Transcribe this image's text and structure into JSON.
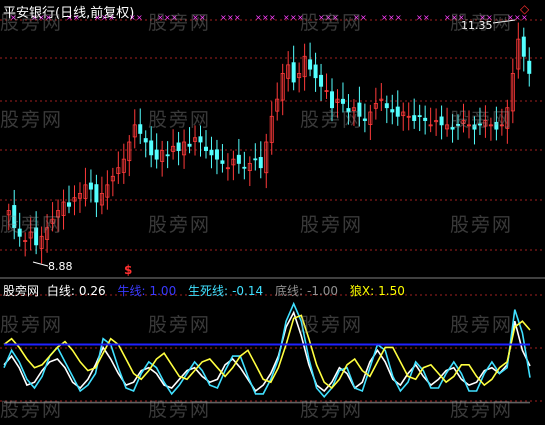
{
  "title": "平安银行(日线,前复权)",
  "price_high_label": "11.35",
  "price_low_label": "8.88",
  "signal_marker": "$",
  "diamond_glyph": "◇",
  "watermark": "股旁网",
  "indicator": {
    "name": "股旁网",
    "items": [
      {
        "label": "白线:",
        "value": "0.26",
        "color": "#ffffff"
      },
      {
        "label": "牛线:",
        "value": "1.00",
        "color": "#3a3aff"
      },
      {
        "label": "生死线:",
        "value": "-0.14",
        "color": "#40e0ff"
      },
      {
        "label": "底线:",
        "value": "-1.00",
        "color": "#808080"
      },
      {
        "label": "狼X:",
        "value": "1.50",
        "color": "#ffff00"
      }
    ]
  },
  "colors": {
    "up": "#ff3a3a",
    "down": "#54ffff",
    "grid": "#a02020",
    "marker": "#ff40ff",
    "white_line": "#ffffff",
    "cyan_line": "#40e0ff",
    "yellow_line": "#ffff40",
    "bull_line": "#2020ff"
  },
  "chart_data": [
    {
      "type": "candlestick",
      "title": "平安银行(日线,前复权)",
      "annotations": [
        "11.35",
        "8.88"
      ],
      "ylim": [
        8.7,
        11.5
      ],
      "close": [
        9.3,
        9.1,
        9.0,
        8.95,
        9.05,
        8.9,
        9.0,
        9.1,
        9.2,
        9.3,
        9.4,
        9.35,
        9.45,
        9.5,
        9.6,
        9.55,
        9.4,
        9.5,
        9.6,
        9.7,
        9.8,
        9.9,
        10.1,
        10.3,
        10.2,
        10.1,
        9.95,
        9.9,
        10.0,
        9.95,
        10.05,
        10.0,
        10.1,
        10.05,
        10.15,
        10.1,
        10.0,
        9.95,
        9.9,
        9.85,
        9.8,
        9.9,
        9.85,
        9.8,
        9.85,
        9.9,
        9.8,
        10.1,
        10.4,
        10.6,
        10.9,
        11.0,
        10.8,
        10.9,
        11.1,
        10.95,
        10.85,
        10.75,
        10.7,
        10.5,
        10.6,
        10.55,
        10.45,
        10.5,
        10.4,
        10.35,
        10.45,
        10.55,
        10.6,
        10.5,
        10.45,
        10.4,
        10.45,
        10.4,
        10.35,
        10.4,
        10.35,
        10.3,
        10.35,
        10.3,
        10.3,
        10.25,
        10.3,
        10.35,
        10.3,
        10.25,
        10.3,
        10.35,
        10.3,
        10.25,
        10.3,
        10.5,
        10.9,
        11.3,
        11.1,
        10.9
      ]
    },
    {
      "type": "line",
      "series": [
        {
          "name": "白线",
          "values": [
            0.3,
            0.6,
            0.2,
            -0.4,
            -0.3,
            0.1,
            0.4,
            0.5,
            0.2,
            -0.3,
            -0.5,
            -0.2,
            0.3,
            0.9,
            0.5,
            0.0,
            -0.4,
            -0.3,
            0.1,
            0.2,
            0.0,
            -0.4,
            -0.5,
            -0.2,
            0.1,
            0.2,
            -0.1,
            -0.3,
            -0.2,
            0.3,
            0.5,
            0.2,
            -0.2,
            -0.6,
            -0.4,
            0.0,
            0.6,
            1.6,
            2.1,
            1.3,
            0.3,
            -0.4,
            -0.6,
            -0.3,
            0.2,
            0.0,
            -0.5,
            -0.3,
            0.4,
            0.8,
            0.4,
            -0.2,
            -0.4,
            0.0,
            0.3,
            -0.1,
            -0.4,
            -0.2,
            0.1,
            0.2,
            -0.2,
            -0.4,
            -0.3,
            0.1,
            0.2,
            0.0,
            0.3,
            1.8,
            0.8,
            0.26
          ]
        },
        {
          "name": "生死线",
          "values": [
            0.2,
            0.8,
            0.4,
            -0.2,
            -0.5,
            -0.1,
            0.6,
            0.9,
            0.4,
            -0.1,
            -0.6,
            -0.4,
            0.0,
            1.2,
            1.0,
            0.2,
            -0.5,
            -0.6,
            0.0,
            0.4,
            0.2,
            -0.3,
            -0.7,
            -0.4,
            0.0,
            0.4,
            0.1,
            -0.4,
            -0.5,
            0.1,
            0.6,
            0.6,
            -0.1,
            -0.7,
            -0.7,
            -0.2,
            0.5,
            1.8,
            2.4,
            1.8,
            0.5,
            -0.5,
            -0.8,
            -0.5,
            0.1,
            0.2,
            -0.5,
            -0.6,
            0.2,
            1.0,
            0.8,
            -0.1,
            -0.6,
            -0.3,
            0.4,
            0.1,
            -0.5,
            -0.5,
            0.0,
            0.4,
            0.0,
            -0.6,
            -0.6,
            0.0,
            0.4,
            0.0,
            0.2,
            2.2,
            1.4,
            -0.14
          ]
        },
        {
          "name": "狼X",
          "values": [
            1.0,
            1.2,
            0.9,
            0.5,
            0.2,
            0.3,
            0.6,
            0.9,
            1.1,
            0.8,
            0.4,
            0.1,
            0.2,
            0.7,
            1.2,
            1.0,
            0.5,
            0.0,
            -0.2,
            0.1,
            0.5,
            0.7,
            0.3,
            -0.1,
            -0.2,
            0.1,
            0.4,
            0.5,
            0.2,
            -0.1,
            0.2,
            0.6,
            0.8,
            0.3,
            -0.2,
            -0.3,
            0.2,
            1.0,
            1.9,
            2.0,
            1.2,
            0.3,
            -0.3,
            -0.5,
            -0.2,
            0.3,
            0.5,
            0.1,
            -0.1,
            0.4,
            0.9,
            0.9,
            0.4,
            -0.1,
            -0.2,
            0.2,
            0.3,
            0.0,
            -0.3,
            -0.1,
            0.3,
            0.3,
            -0.1,
            -0.4,
            -0.2,
            0.2,
            0.4,
            1.6,
            1.8,
            1.5
          ]
        },
        {
          "name": "牛线",
          "values": [
            1.0,
            1.0
          ]
        },
        {
          "name": "底线",
          "values": [
            -1.0,
            -1.0
          ]
        }
      ],
      "ylim": [
        -1.6,
        2.6
      ]
    }
  ]
}
